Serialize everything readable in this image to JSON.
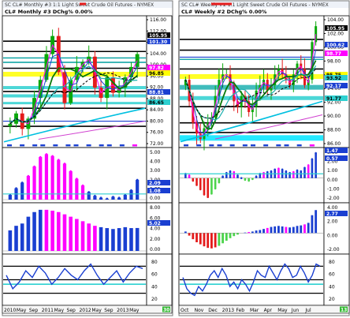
{
  "panels": [
    {
      "id": "left",
      "title_bar": "SC CL# Monthly #3 1:1  Light Sweet Crude Oil Futures - NYMEX",
      "header": "CL# Monthly #3 DChg% 0.00%",
      "price_ticks": [
        "116.00",
        "112.00",
        "108.00",
        "104.00",
        "100.00",
        "96.00",
        "92.00",
        "88.00",
        "84.00",
        "80.00",
        "76.00",
        "72.00"
      ],
      "price_flags": [
        {
          "text": "105.95",
          "color": "#000000"
        },
        {
          "text": "101.30",
          "color": "#1a3fd1"
        },
        {
          "text": "97.82",
          "color": "#ff00ff"
        },
        {
          "text": "96.85",
          "color": "#ffff00"
        },
        {
          "text": "88.81",
          "color": "#1a3fd1"
        },
        {
          "text": "86.65",
          "color": "#2dd0d0"
        }
      ],
      "ind1_ticks": [
        "5.00",
        "4.00",
        "3.00",
        "2.00",
        "1.00",
        "0.00"
      ],
      "ind1_flags": [
        {
          "text": "2.09",
          "color": "#1a3fd1"
        },
        {
          "text": "1.08",
          "color": "#1a3fd1"
        }
      ],
      "ind2_ticks": [
        "8.00",
        "6.00",
        "4.00",
        "2.00",
        "0.00"
      ],
      "ind2_flags": [
        {
          "text": "5.02",
          "color": "#1a3fd1"
        }
      ],
      "osc_ticks": [
        "80",
        "60",
        "40",
        "20"
      ],
      "date_labels": [
        "2010",
        "May",
        "Sep",
        "2011",
        "May",
        "Sep",
        "2012",
        "May",
        "Sep",
        "2013",
        "May"
      ],
      "corner_badge": "30"
    },
    {
      "id": "right",
      "title_bar": "SC CL# Weekly #2 1:1  Light Sweet Crude Oil Futures - NYMEX",
      "header": "CL# Weekly #2 DChg% 0.00%",
      "price_ticks": [
        "104.00",
        "102.00",
        "100.00",
        "98.00",
        "96.00",
        "94.00",
        "92.00",
        "90.00",
        "88.00",
        "86.00"
      ],
      "price_flags": [
        {
          "text": "105.95",
          "color": "#000000"
        },
        {
          "text": "100.62",
          "color": "#1a3fd1"
        },
        {
          "text": "98.77",
          "color": "#ff00ff"
        },
        {
          "text": "95.75",
          "color": "#ffff00"
        },
        {
          "text": "93.92",
          "color": "#2dd0d0"
        },
        {
          "text": "92.17",
          "color": "#1a3fd1"
        },
        {
          "text": "91.77",
          "color": "#2dd0d0"
        }
      ],
      "ind1_ticks": [
        "3.00",
        "2.00",
        "1.00",
        "0.00",
        "-1.00",
        "-2.00"
      ],
      "ind1_flags": [
        {
          "text": "1.47",
          "color": "#1a3fd1"
        },
        {
          "text": "0.57",
          "color": "#1a3fd1"
        }
      ],
      "ind2_ticks": [
        "4.00",
        "2.00",
        "0.00",
        "-2.00"
      ],
      "ind2_flags": [
        {
          "text": "2.77",
          "color": "#1a3fd1"
        }
      ],
      "osc_ticks": [
        "80",
        "60",
        "40",
        "20"
      ],
      "date_labels": [
        "Oct",
        "Nov",
        "Dec",
        "2013",
        "Feb",
        "Mar",
        "Apr",
        "May",
        "Jun",
        "Jul"
      ],
      "corner_badge": "13"
    }
  ],
  "chart_data": [
    {
      "type": "candlestick",
      "title": "CL# Monthly #3 DChg% 0.00%",
      "ylim": [
        70,
        118
      ],
      "x": [
        "2010",
        "May",
        "Sep",
        "2011",
        "May",
        "Sep",
        "2012",
        "May",
        "Sep",
        "2013",
        "May"
      ],
      "close": [
        78,
        82,
        76,
        80,
        88,
        95,
        105,
        112,
        98,
        86,
        95,
        100,
        102,
        104,
        92,
        88,
        96,
        90,
        92,
        96,
        100,
        105
      ],
      "ind1_histogram": [
        0.5,
        1.2,
        1.8,
        2.5,
        3.5,
        4.5,
        4.8,
        4.6,
        4.2,
        3.8,
        3.0,
        2.2,
        1.5,
        0.8,
        0.4,
        0.2,
        0.1,
        0.3,
        0.2,
        0.5,
        1.0,
        2.09
      ],
      "ind2_histogram": [
        4.5,
        5.5,
        6.0,
        7.5,
        8.5,
        9.0,
        9.0,
        8.8,
        8.5,
        8.0,
        7.5,
        7.0,
        6.5,
        6.0,
        5.5,
        5.2,
        5.0,
        4.8,
        5.0,
        5.2,
        5.0,
        5.02
      ],
      "osc": [
        60,
        30,
        45,
        70,
        55,
        80,
        65,
        40,
        55,
        75,
        60,
        50,
        70,
        85,
        60,
        40,
        55,
        70,
        45,
        65,
        80,
        75
      ]
    },
    {
      "type": "candlestick",
      "title": "CL# Weekly #2 DChg% 0.00%",
      "ylim": [
        84,
        107
      ],
      "x": [
        "Oct",
        "Nov",
        "Dec",
        "2013",
        "Feb",
        "Mar",
        "Apr",
        "May",
        "Jun",
        "Jul"
      ],
      "close": [
        96,
        92,
        88,
        86,
        85,
        87,
        88,
        89,
        93,
        96,
        97,
        97,
        95,
        92,
        91,
        93,
        92,
        90,
        91,
        94,
        95,
        96,
        94,
        95,
        97,
        98,
        97,
        96,
        95,
        97,
        99,
        98,
        95,
        96,
        103,
        105.95
      ],
      "ind1_histogram": [
        0.5,
        0.3,
        -0.3,
        -0.8,
        -1.3,
        -1.9,
        -2.2,
        -1.8,
        -1.2,
        -0.5,
        0.2,
        0.6,
        0.8,
        0.7,
        0.3,
        0.0,
        -0.2,
        -0.3,
        -0.1,
        0.2,
        0.5,
        0.6,
        0.7,
        0.8,
        1.0,
        1.1,
        1.0,
        0.8,
        0.6,
        0.7,
        0.9,
        0.8,
        1.2,
        1.5,
        2.2,
        2.9
      ],
      "ind2_histogram": [
        0.3,
        -0.5,
        -1.2,
        -1.8,
        -2.2,
        -2.6,
        -2.9,
        -3.0,
        -2.8,
        -2.5,
        -2.0,
        -1.5,
        -1.0,
        -0.6,
        -0.3,
        0.0,
        0.1,
        0.2,
        0.3,
        0.5,
        0.6,
        0.8,
        1.0,
        1.2,
        1.3,
        1.4,
        1.3,
        1.2,
        1.1,
        1.2,
        1.4,
        1.5,
        1.7,
        2.0,
        3.5,
        4.5
      ],
      "osc": [
        55,
        30,
        20,
        15,
        35,
        25,
        40,
        60,
        70,
        55,
        75,
        60,
        35,
        45,
        30,
        50,
        40,
        25,
        45,
        70,
        60,
        55,
        80,
        65,
        50,
        70,
        85,
        75,
        55,
        60,
        80,
        65,
        45,
        60,
        85,
        80
      ]
    }
  ]
}
